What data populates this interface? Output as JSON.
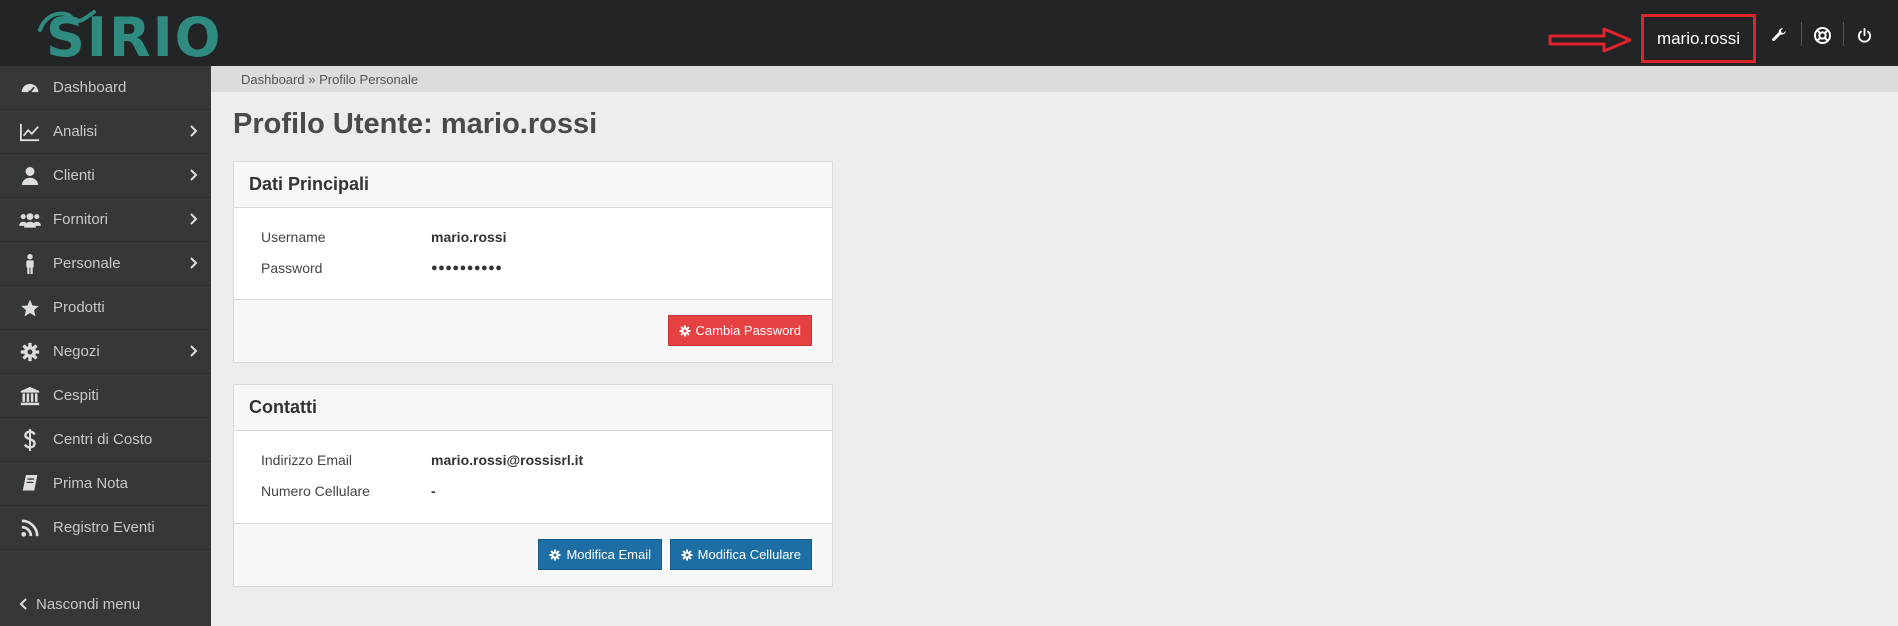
{
  "app": {
    "logo_text": "SIRIO"
  },
  "topbar": {
    "username": "mario.rossi",
    "icons": [
      "wrench-icon",
      "lifebuoy-icon",
      "power-icon"
    ]
  },
  "breadcrumb": {
    "home": "Dashboard",
    "separator": " » ",
    "current": "Profilo Personale"
  },
  "sidebar": {
    "items": [
      {
        "label": "Dashboard",
        "icon": "dashboard-icon",
        "submenu": false
      },
      {
        "label": "Analisi",
        "icon": "line-chart-icon",
        "submenu": true
      },
      {
        "label": "Clienti",
        "icon": "user-icon",
        "submenu": true
      },
      {
        "label": "Fornitori",
        "icon": "users-icon",
        "submenu": true
      },
      {
        "label": "Personale",
        "icon": "person-icon",
        "submenu": true
      },
      {
        "label": "Prodotti",
        "icon": "star-icon",
        "submenu": false
      },
      {
        "label": "Negozi",
        "icon": "gear-icon",
        "submenu": true
      },
      {
        "label": "Cespiti",
        "icon": "bank-icon",
        "submenu": false
      },
      {
        "label": "Centri di Costo",
        "icon": "dollar-icon",
        "submenu": false
      },
      {
        "label": "Prima Nota",
        "icon": "book-icon",
        "submenu": false
      },
      {
        "label": "Registro Eventi",
        "icon": "rss-icon",
        "submenu": false
      }
    ],
    "hide_menu": "Nascondi menu"
  },
  "main": {
    "title": "Profilo Utente: mario.rossi",
    "dati": {
      "heading": "Dati Principali",
      "username_label": "Username",
      "username_value": "mario.rossi",
      "password_label": "Password",
      "password_value": "●●●●●●●●●●",
      "change_password": "Cambia Password"
    },
    "contatti": {
      "heading": "Contatti",
      "email_label": "Indirizzo Email",
      "email_value": "mario.rossi@rossisrl.it",
      "phone_label": "Numero Cellulare",
      "phone_value": "-",
      "edit_email": "Modifica Email",
      "edit_phone": "Modifica Cellulare"
    }
  },
  "colors": {
    "topbar": "#222425",
    "sidebar": "#353839",
    "brand": "#2f8a80",
    "danger": "#e54141",
    "primary": "#1c6ea4",
    "highlight": "#e0242b"
  }
}
